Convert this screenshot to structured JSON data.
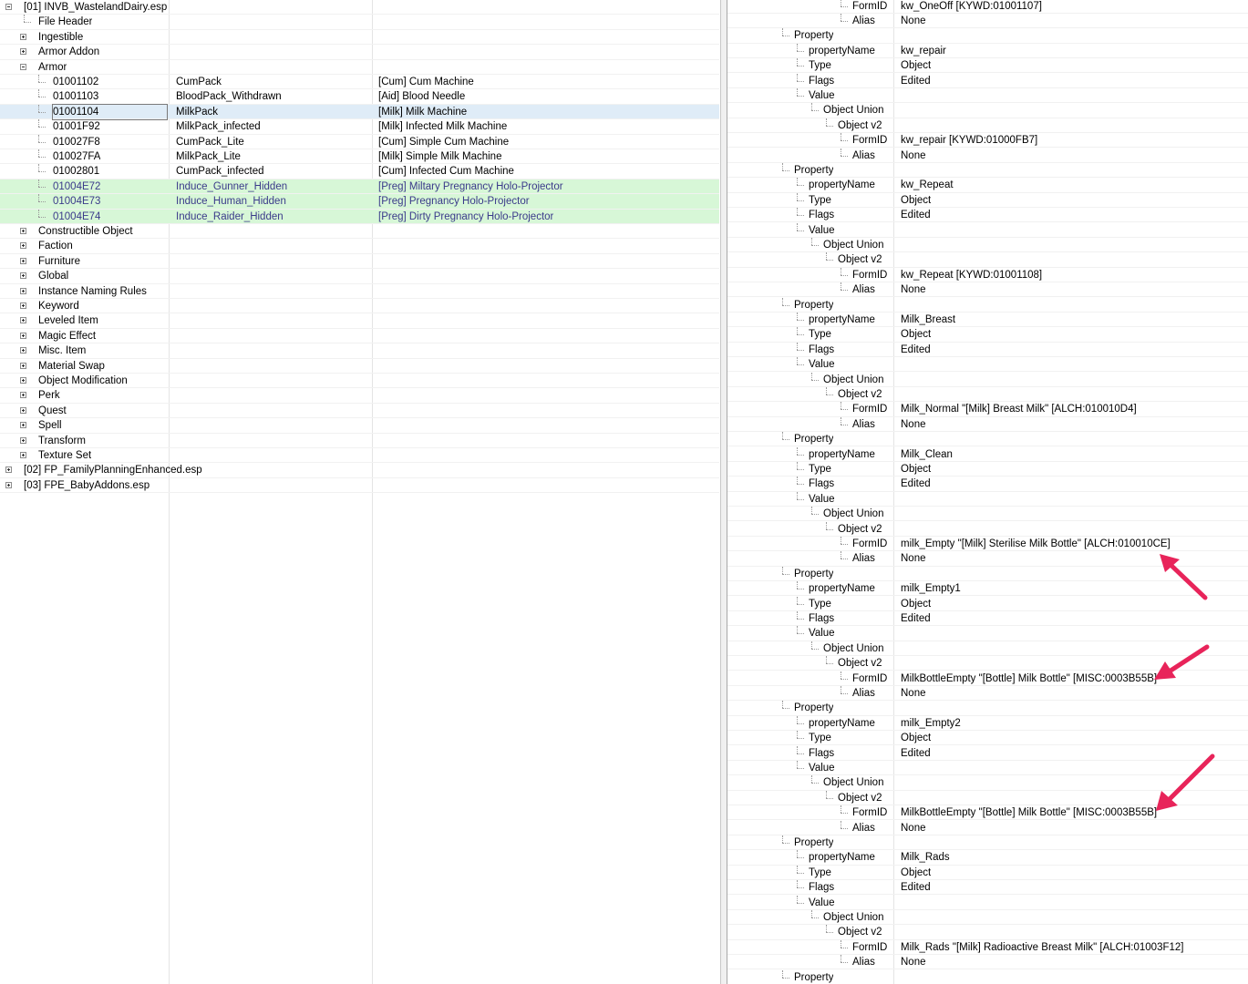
{
  "left_tree": [
    {
      "level": 0,
      "expander": "minus",
      "label": "[01] INVB_WastelandDairy.esp"
    },
    {
      "level": 1,
      "expander": "none",
      "label": "File Header"
    },
    {
      "level": 1,
      "expander": "plus",
      "label": "Ingestible"
    },
    {
      "level": 1,
      "expander": "plus",
      "label": "Armor Addon"
    },
    {
      "level": 1,
      "expander": "minus",
      "label": "Armor"
    },
    {
      "level": 2,
      "expander": "none",
      "label": "01001102",
      "editor_id": "CumPack",
      "name": "[Cum] Cum Machine"
    },
    {
      "level": 2,
      "expander": "none",
      "label": "01001103",
      "editor_id": "BloodPack_Withdrawn",
      "name": "[Aid] Blood Needle"
    },
    {
      "level": 2,
      "expander": "none",
      "label": "01001104",
      "editor_id": "MilkPack",
      "name": "[Milk] Milk Machine",
      "state": "selected"
    },
    {
      "level": 2,
      "expander": "none",
      "label": "01001F92",
      "editor_id": "MilkPack_infected",
      "name": "[Milk] Infected Milk Machine"
    },
    {
      "level": 2,
      "expander": "none",
      "label": "010027F8",
      "editor_id": "CumPack_Lite",
      "name": "[Cum] Simple Cum Machine"
    },
    {
      "level": 2,
      "expander": "none",
      "label": "010027FA",
      "editor_id": "MilkPack_Lite",
      "name": "[Milk] Simple Milk Machine"
    },
    {
      "level": 2,
      "expander": "none",
      "label": "01002801",
      "editor_id": "CumPack_infected",
      "name": "[Cum] Infected Cum Machine"
    },
    {
      "level": 2,
      "expander": "none",
      "label": "01004E72",
      "editor_id": "Induce_Gunner_Hidden",
      "name": "[Preg] Miltary Pregnancy Holo-Projector",
      "state": "highlight"
    },
    {
      "level": 2,
      "expander": "none",
      "label": "01004E73",
      "editor_id": "Induce_Human_Hidden",
      "name": "[Preg] Pregnancy Holo-Projector",
      "state": "highlight"
    },
    {
      "level": 2,
      "expander": "none",
      "label": "01004E74",
      "editor_id": "Induce_Raider_Hidden",
      "name": "[Preg] Dirty Pregnancy Holo-Projector",
      "state": "highlight"
    },
    {
      "level": 1,
      "expander": "plus",
      "label": "Constructible Object"
    },
    {
      "level": 1,
      "expander": "plus",
      "label": "Faction"
    },
    {
      "level": 1,
      "expander": "plus",
      "label": "Furniture"
    },
    {
      "level": 1,
      "expander": "plus",
      "label": "Global"
    },
    {
      "level": 1,
      "expander": "plus",
      "label": "Instance Naming Rules"
    },
    {
      "level": 1,
      "expander": "plus",
      "label": "Keyword"
    },
    {
      "level": 1,
      "expander": "plus",
      "label": "Leveled Item"
    },
    {
      "level": 1,
      "expander": "plus",
      "label": "Magic Effect"
    },
    {
      "level": 1,
      "expander": "plus",
      "label": "Misc. Item"
    },
    {
      "level": 1,
      "expander": "plus",
      "label": "Material Swap"
    },
    {
      "level": 1,
      "expander": "plus",
      "label": "Object Modification"
    },
    {
      "level": 1,
      "expander": "plus",
      "label": "Perk"
    },
    {
      "level": 1,
      "expander": "plus",
      "label": "Quest"
    },
    {
      "level": 1,
      "expander": "plus",
      "label": "Spell"
    },
    {
      "level": 1,
      "expander": "plus",
      "label": "Transform"
    },
    {
      "level": 1,
      "expander": "plus",
      "label": "Texture Set"
    },
    {
      "level": 0,
      "expander": "plus",
      "label": "[02] FP_FamilyPlanningEnhanced.esp"
    },
    {
      "level": 0,
      "expander": "plus",
      "label": "[03] FPE_BabyAddons.esp"
    }
  ],
  "right_rows": [
    {
      "level": 4,
      "label": "FormID",
      "value": "kw_OneOff [KYWD:01001107]"
    },
    {
      "level": 4,
      "label": "Alias",
      "value": "None"
    },
    {
      "level": 0,
      "label": "Property",
      "value": ""
    },
    {
      "level": 1,
      "label": "propertyName",
      "value": "kw_repair"
    },
    {
      "level": 1,
      "label": "Type",
      "value": "Object"
    },
    {
      "level": 1,
      "label": "Flags",
      "value": "Edited"
    },
    {
      "level": 1,
      "label": "Value",
      "value": ""
    },
    {
      "level": 2,
      "label": "Object Union",
      "value": ""
    },
    {
      "level": 3,
      "label": "Object v2",
      "value": ""
    },
    {
      "level": 4,
      "label": "FormID",
      "value": "kw_repair [KYWD:01000FB7]"
    },
    {
      "level": 4,
      "label": "Alias",
      "value": "None"
    },
    {
      "level": 0,
      "label": "Property",
      "value": ""
    },
    {
      "level": 1,
      "label": "propertyName",
      "value": "kw_Repeat"
    },
    {
      "level": 1,
      "label": "Type",
      "value": "Object"
    },
    {
      "level": 1,
      "label": "Flags",
      "value": "Edited"
    },
    {
      "level": 1,
      "label": "Value",
      "value": ""
    },
    {
      "level": 2,
      "label": "Object Union",
      "value": ""
    },
    {
      "level": 3,
      "label": "Object v2",
      "value": ""
    },
    {
      "level": 4,
      "label": "FormID",
      "value": "kw_Repeat [KYWD:01001108]"
    },
    {
      "level": 4,
      "label": "Alias",
      "value": "None"
    },
    {
      "level": 0,
      "label": "Property",
      "value": ""
    },
    {
      "level": 1,
      "label": "propertyName",
      "value": "Milk_Breast"
    },
    {
      "level": 1,
      "label": "Type",
      "value": "Object"
    },
    {
      "level": 1,
      "label": "Flags",
      "value": "Edited"
    },
    {
      "level": 1,
      "label": "Value",
      "value": ""
    },
    {
      "level": 2,
      "label": "Object Union",
      "value": ""
    },
    {
      "level": 3,
      "label": "Object v2",
      "value": ""
    },
    {
      "level": 4,
      "label": "FormID",
      "value": "Milk_Normal \"[Milk] Breast Milk\" [ALCH:010010D4]"
    },
    {
      "level": 4,
      "label": "Alias",
      "value": "None"
    },
    {
      "level": 0,
      "label": "Property",
      "value": ""
    },
    {
      "level": 1,
      "label": "propertyName",
      "value": "Milk_Clean"
    },
    {
      "level": 1,
      "label": "Type",
      "value": "Object"
    },
    {
      "level": 1,
      "label": "Flags",
      "value": "Edited"
    },
    {
      "level": 1,
      "label": "Value",
      "value": ""
    },
    {
      "level": 2,
      "label": "Object Union",
      "value": ""
    },
    {
      "level": 3,
      "label": "Object v2",
      "value": ""
    },
    {
      "level": 4,
      "label": "FormID",
      "value": "milk_Empty \"[Milk] Sterilise Milk Bottle\" [ALCH:010010CE]"
    },
    {
      "level": 4,
      "label": "Alias",
      "value": "None"
    },
    {
      "level": 0,
      "label": "Property",
      "value": ""
    },
    {
      "level": 1,
      "label": "propertyName",
      "value": "milk_Empty1"
    },
    {
      "level": 1,
      "label": "Type",
      "value": "Object"
    },
    {
      "level": 1,
      "label": "Flags",
      "value": "Edited"
    },
    {
      "level": 1,
      "label": "Value",
      "value": ""
    },
    {
      "level": 2,
      "label": "Object Union",
      "value": ""
    },
    {
      "level": 3,
      "label": "Object v2",
      "value": ""
    },
    {
      "level": 4,
      "label": "FormID",
      "value": "MilkBottleEmpty \"[Bottle] Milk Bottle\" [MISC:0003B55B]"
    },
    {
      "level": 4,
      "label": "Alias",
      "value": "None"
    },
    {
      "level": 0,
      "label": "Property",
      "value": ""
    },
    {
      "level": 1,
      "label": "propertyName",
      "value": "milk_Empty2"
    },
    {
      "level": 1,
      "label": "Type",
      "value": "Object"
    },
    {
      "level": 1,
      "label": "Flags",
      "value": "Edited"
    },
    {
      "level": 1,
      "label": "Value",
      "value": ""
    },
    {
      "level": 2,
      "label": "Object Union",
      "value": ""
    },
    {
      "level": 3,
      "label": "Object v2",
      "value": ""
    },
    {
      "level": 4,
      "label": "FormID",
      "value": "MilkBottleEmpty \"[Bottle] Milk Bottle\" [MISC:0003B55B]"
    },
    {
      "level": 4,
      "label": "Alias",
      "value": "None"
    },
    {
      "level": 0,
      "label": "Property",
      "value": ""
    },
    {
      "level": 1,
      "label": "propertyName",
      "value": "Milk_Rads"
    },
    {
      "level": 1,
      "label": "Type",
      "value": "Object"
    },
    {
      "level": 1,
      "label": "Flags",
      "value": "Edited"
    },
    {
      "level": 1,
      "label": "Value",
      "value": ""
    },
    {
      "level": 2,
      "label": "Object Union",
      "value": ""
    },
    {
      "level": 3,
      "label": "Object v2",
      "value": ""
    },
    {
      "level": 4,
      "label": "FormID",
      "value": "Milk_Rads \"[Milk] Radioactive Breast Milk\" [ALCH:01003F12]"
    },
    {
      "level": 4,
      "label": "Alias",
      "value": "None"
    },
    {
      "level": 0,
      "label": "Property",
      "value": ""
    }
  ],
  "annotations": {
    "arrow_color": "#e8245a",
    "arrows": [
      "annotation-arrow-1",
      "annotation-arrow-2",
      "annotation-arrow-3"
    ]
  }
}
